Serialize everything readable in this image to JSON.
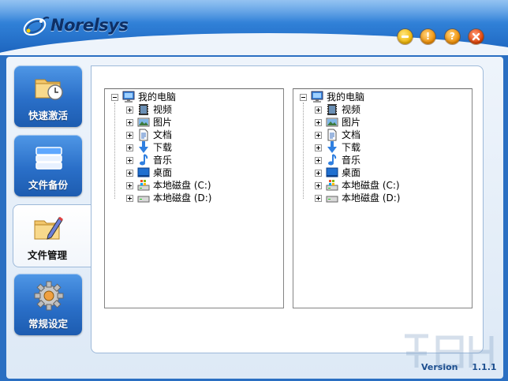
{
  "app": {
    "logo_text": "Norelsys",
    "version_label": "Version",
    "version_number": "1.1.1"
  },
  "title_buttons": {
    "minimize": "minimize",
    "warning": "!",
    "help": "?",
    "close": "close"
  },
  "sidebar": {
    "items": [
      {
        "label": "快速激活",
        "icon": "folder-clock-icon",
        "active": false
      },
      {
        "label": "文件备份",
        "icon": "stack-icon",
        "active": false
      },
      {
        "label": "文件管理",
        "icon": "folder-pencil-icon",
        "active": true
      },
      {
        "label": "常规设定",
        "icon": "gear-icon",
        "active": false
      }
    ]
  },
  "left_tree": {
    "root": "我的电脑",
    "children": [
      "视频",
      "图片",
      "文档",
      "下载",
      "音乐",
      "桌面",
      "本地磁盘 (C:)",
      "本地磁盘 (D:)"
    ]
  },
  "right_tree": {
    "root": "我的电脑",
    "children": [
      "视频",
      "图片",
      "文档",
      "下载",
      "音乐",
      "桌面",
      "本地磁盘 (C:)",
      "本地磁盘 (D:)"
    ]
  },
  "colors": {
    "header_blue": "#2f7fd6",
    "nav_blue": "#2a6fc8",
    "panel_border": "#9db9d9",
    "version_text": "#1d4f8f"
  }
}
